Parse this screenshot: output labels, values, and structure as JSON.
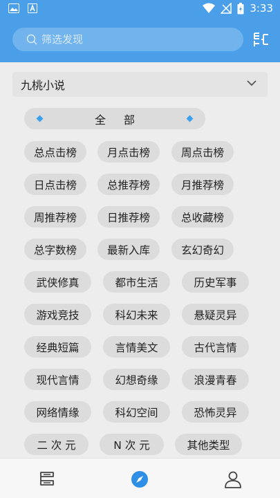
{
  "status_bar": {
    "time": "3:33"
  },
  "search": {
    "placeholder": "筛选发现"
  },
  "source": {
    "selected": "九桃小说"
  },
  "all_label": "全部",
  "categories": [
    "总点击榜",
    "月点击榜",
    "周点击榜",
    "日点击榜",
    "总推荐榜",
    "月推荐榜",
    "周推荐榜",
    "日推荐榜",
    "总收藏榜",
    "总字数榜",
    "最新入库",
    "玄幻奇幻",
    "武侠修真",
    "都市生活",
    "历史军事",
    "游戏竞技",
    "科幻未来",
    "悬疑灵异",
    "经典短篇",
    "言情美文",
    "古代言情",
    "现代言情",
    "幻想奇缘",
    "浪漫青春",
    "网络情缘",
    "科幻空间",
    "恐怖灵异",
    "二 次 元",
    "N 次 元",
    "其他类型"
  ],
  "colors": {
    "primary": "#4a9fe8",
    "chip_bg": "#dcdcdc",
    "accent": "#3ba1ee",
    "nav_active": "#2f8fe6"
  },
  "bottom_nav": [
    "bookshelf-icon",
    "explore-icon",
    "user-icon"
  ]
}
